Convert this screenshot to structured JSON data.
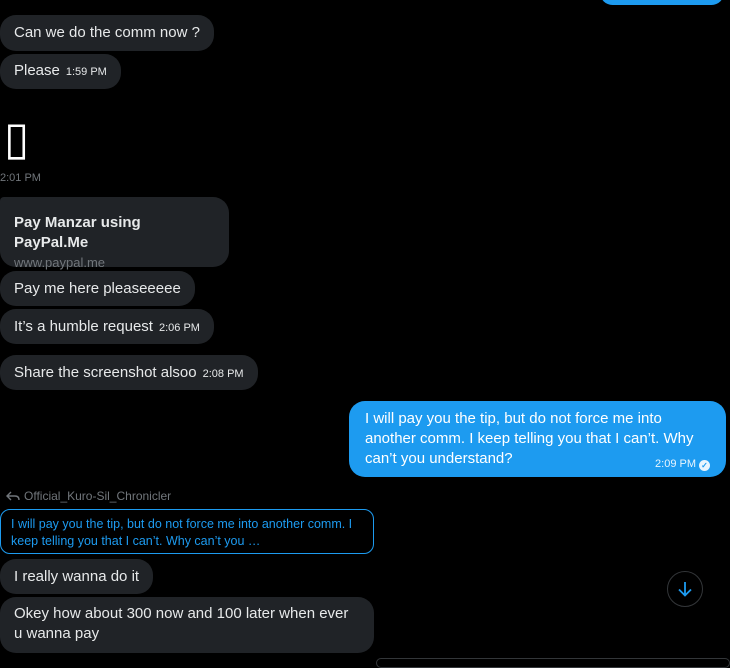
{
  "messages": {
    "m1": "Can we do the comm now ?",
    "m2": "Please",
    "m2_time": "1:59 PM",
    "placeholder_glyph": "▯",
    "placeholder_time": "2:01 PM",
    "link_title": "Pay Manzar using PayPal.Me",
    "link_domain": "www.paypal.me",
    "m3": "Pay me here pleaseeeee",
    "m4": "It’s a humble request",
    "m4_time": "2:06 PM",
    "m5": "Share the screenshot alsoo",
    "m5_time": "2:08 PM",
    "sent1": "I will pay you the tip, but do not force me into another comm. I keep telling you that I can’t. Why can’t you understand?",
    "sent1_time": "2:09 PM",
    "reply_author": "Official_Kuro-Sil_Chronicler",
    "reply_quote": "I will pay you the tip, but do not force me into another comm. I keep telling you that I can’t. Why can’t you …",
    "m6": "I really wanna do it",
    "m7": "Okey how about 300 now and 100 later when ever u wanna pay"
  },
  "colors": {
    "background": "#000000",
    "received_bubble": "#202327",
    "sent_bubble": "#1d9bf0",
    "muted_text": "#71767b",
    "accent": "#1d9bf0"
  },
  "icons": {
    "reply": "reply-arrow-icon",
    "read_receipt": "check-circle-icon",
    "scroll_down": "arrow-down-icon"
  }
}
